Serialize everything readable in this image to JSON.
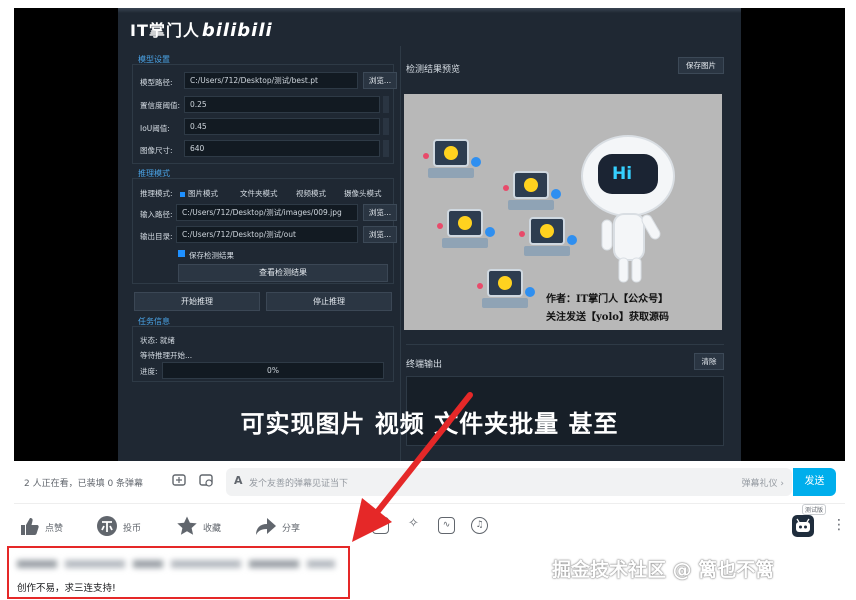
{
  "app": {
    "title": "IT掌门人",
    "title_brand": "bilibili",
    "model_section": "模型设置",
    "model_path_label": "模型路径:",
    "model_path_value": "C:/Users/712/Desktop/测试/best.pt",
    "browse_label": "浏览...",
    "conf_label": "置信度阈值:",
    "conf_value": "0.25",
    "iou_label": "IoU阈值:",
    "iou_value": "0.45",
    "imgsize_label": "图像尺寸:",
    "imgsize_value": "640",
    "infer_section": "推理模式",
    "infer_mode_label": "推理模式:",
    "modes": [
      "图片模式",
      "文件夹模式",
      "视频模式",
      "摄像头模式"
    ],
    "input_path_label": "输入路径:",
    "input_path_value": "C:/Users/712/Desktop/测试/images/009.jpg",
    "output_dir_label": "输出目录:",
    "output_dir_value": "C:/Users/712/Desktop/测试/out",
    "save_results_label": "保存检测结果",
    "view_results_btn": "查看检测结果",
    "start_btn": "开始推理",
    "stop_btn": "停止推理",
    "task_section": "任务信息",
    "status_text": "状态: 就绪",
    "waiting_text": "等待推理开始...",
    "progress_label": "进度:",
    "progress_value": "0%",
    "preview_title": "检测结果预览",
    "save_image_btn": "保存图片",
    "terminal_title": "终端输出",
    "clear_btn": "清除",
    "preview_line1": "作者：IT掌门人【公众号】",
    "preview_line2": "关注发送【yolo】获取源码",
    "robot_text": "Hi"
  },
  "caption": "可实现图片 视频 文件夹批量 甚至",
  "danmaku": {
    "viewers": "2 人正在看，已装填 0 条弹幕",
    "placeholder": "发个友善的弹幕见证当下",
    "etiquette": "弹幕礼仪 ›",
    "send": "发送"
  },
  "actions": {
    "like": "点赞",
    "coin": "投币",
    "fav": "收藏",
    "share": "分享",
    "bot_tag": "测试版"
  },
  "comment": {
    "text": "创作不易，求三连支持!"
  },
  "watermark": "掘金技术社区 @ 篱也不篱",
  "colors": {
    "accent": "#00aeec",
    "app_bg": "#1f2833",
    "highlight_red": "#e52828",
    "section_blue": "#4aa3e6"
  }
}
